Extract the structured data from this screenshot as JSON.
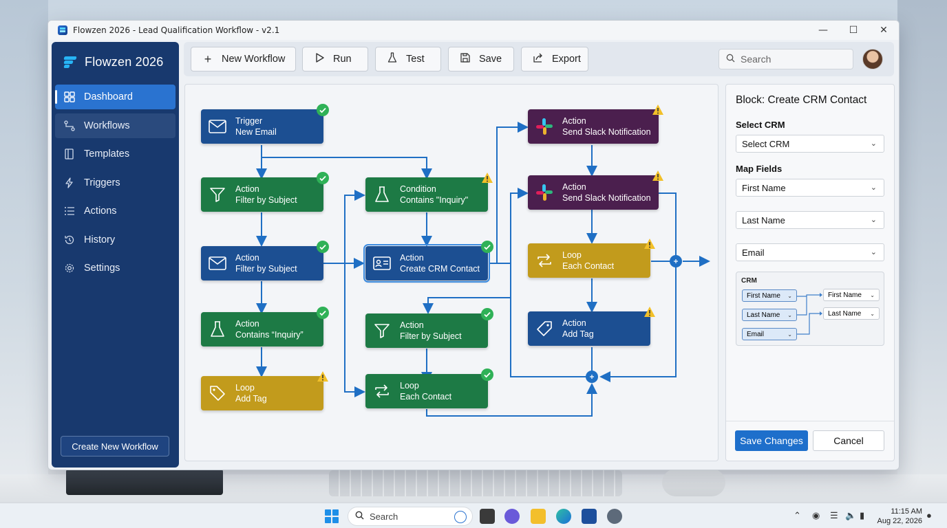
{
  "window": {
    "title": "Flowzen 2026 - Lead Qualification Workflow - v2.1",
    "controls": {
      "minimize": "—",
      "maximize": "☐",
      "close": "✕"
    }
  },
  "sidebar": {
    "brand": "Flowzen 2026",
    "items": [
      {
        "label": "Dashboard",
        "icon": "grid-icon",
        "active": true
      },
      {
        "label": "Workflows",
        "icon": "workflow-icon",
        "active": false
      },
      {
        "label": "Templates",
        "icon": "templates-icon",
        "active": false
      },
      {
        "label": "Triggers",
        "icon": "lightning-icon",
        "active": false
      },
      {
        "label": "Actions",
        "icon": "list-icon",
        "active": false
      },
      {
        "label": "History",
        "icon": "history-icon",
        "active": false
      },
      {
        "label": "Settings",
        "icon": "gear-icon",
        "active": false
      }
    ],
    "create_button": "Create New Workflow"
  },
  "toolbar": {
    "new_workflow": "New Workflow",
    "run": "Run",
    "test": "Test",
    "save": "Save",
    "export": "Export",
    "search_placeholder": "Search"
  },
  "nodes": {
    "trigger": {
      "type": "Trigger",
      "label": "New Email",
      "status": "ok"
    },
    "filter1": {
      "type": "Action",
      "label": "Filter by Subject",
      "status": "ok"
    },
    "filter2": {
      "type": "Action",
      "label": "Filter by Subject",
      "status": "ok"
    },
    "contains": {
      "type": "Action",
      "label": "Contains “Inquiry”",
      "status": "ok"
    },
    "loop_tag": {
      "type": "Loop",
      "label": "Add Tag",
      "status": "warning"
    },
    "condition": {
      "type": "Condition",
      "label": "Contains \"Inquiry\"",
      "status": "warning"
    },
    "crm": {
      "type": "Action",
      "label": "Create CRM Contact",
      "status": "ok"
    },
    "filter3": {
      "type": "Action",
      "label": "Filter by Subject",
      "status": "ok"
    },
    "loop_contact": {
      "type": "Loop",
      "label": "Each Contact",
      "status": "ok"
    },
    "slack1": {
      "type": "Action",
      "label": "Send Slack Notification",
      "status": "warning"
    },
    "slack2": {
      "type": "Action",
      "label": "Send Slack Notification",
      "status": "warning"
    },
    "loop_each": {
      "type": "Loop",
      "label": "Each Contact",
      "status": "warning"
    },
    "add_tag": {
      "type": "Action",
      "label": "Add Tag",
      "status": "warning"
    }
  },
  "panel": {
    "title": "Block: Create CRM Contact",
    "select_crm_label": "Select CRM",
    "select_crm_value": "Select CRM",
    "map_fields_label": "Map Fields",
    "fields": [
      "First Name",
      "Last Name",
      "Email"
    ],
    "mapping": {
      "label": "CRM",
      "source": [
        "First Name",
        "Last Name",
        "Email"
      ],
      "target": [
        "First Name",
        "Last Name"
      ]
    },
    "save_button": "Save Changes",
    "cancel_button": "Cancel"
  },
  "taskbar": {
    "search": "Search",
    "time": "11:15 AM",
    "date": "Aug 22, 2026"
  },
  "colors": {
    "sidebar": "#18396e",
    "accent": "#2a73d0",
    "node_blue": "#1c4f92",
    "node_green": "#1d7a45",
    "node_gold": "#c29b1c",
    "node_purple": "#4b1f4e",
    "ok": "#2fb157",
    "warning": "#f2c029"
  }
}
